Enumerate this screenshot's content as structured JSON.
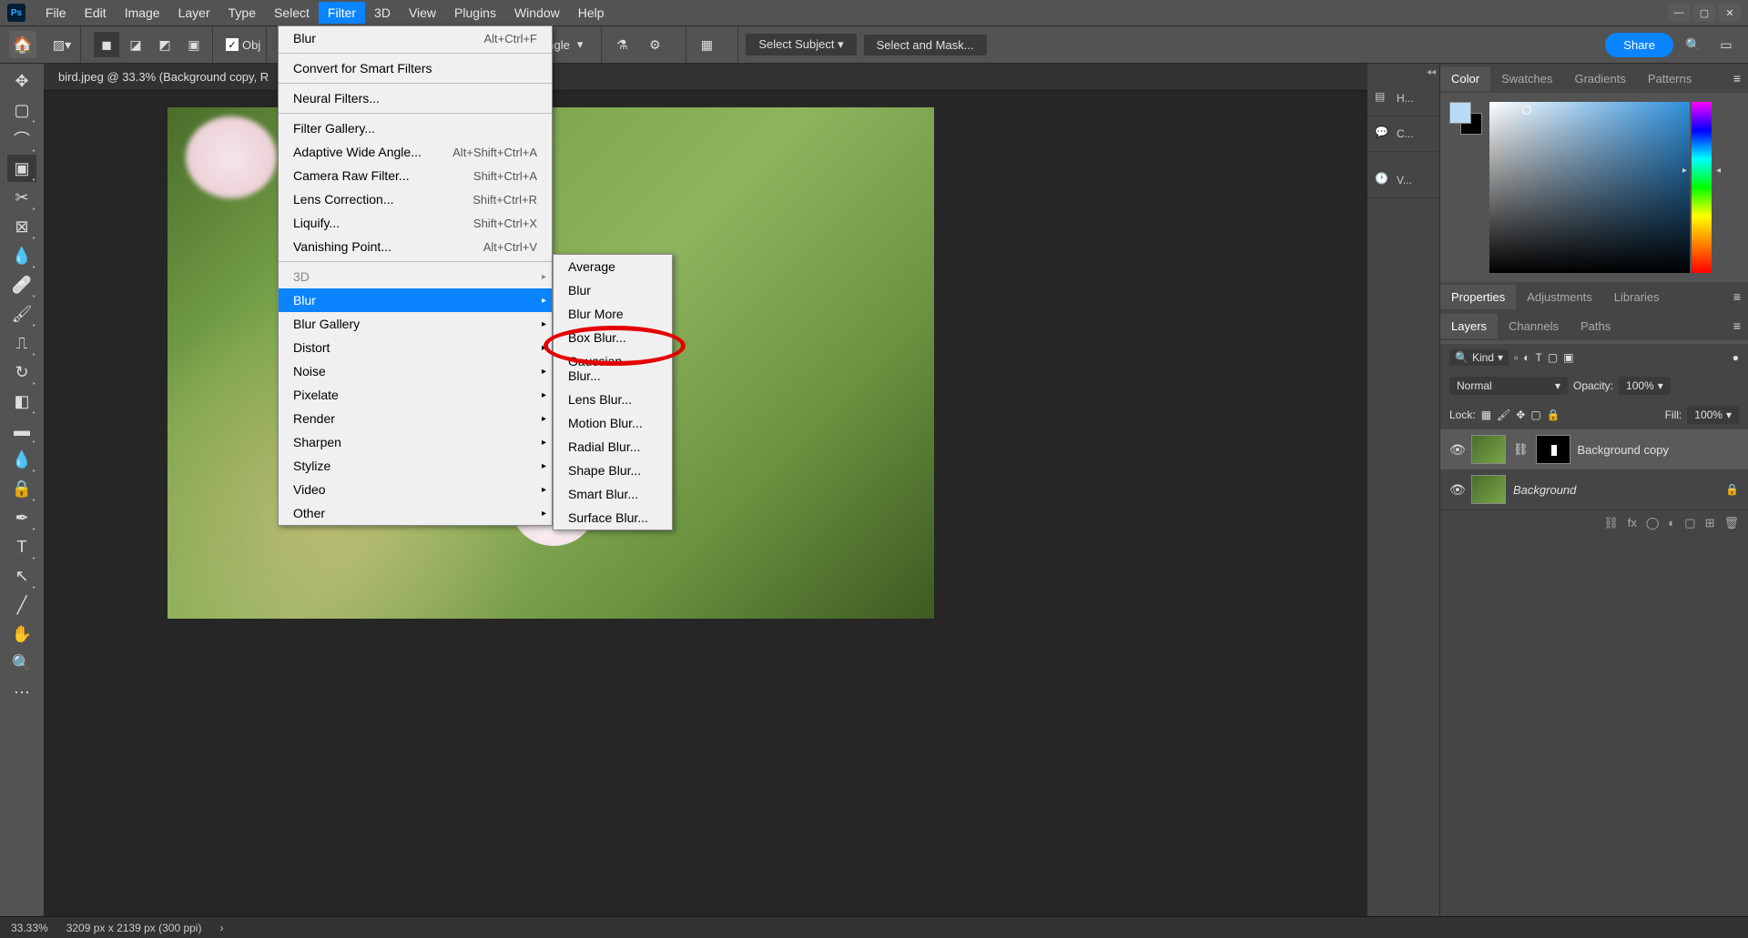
{
  "menubar": {
    "items": [
      "File",
      "Edit",
      "Image",
      "Layer",
      "Type",
      "Select",
      "Filter",
      "3D",
      "View",
      "Plugins",
      "Window",
      "Help"
    ],
    "active": "Filter"
  },
  "optionsbar": {
    "obj_label": "Obj",
    "style_label": "ngle",
    "select_subject": "Select Subject",
    "select_mask": "Select and Mask...",
    "share": "Share"
  },
  "doc_tab": "bird.jpeg @ 33.3% (Background copy, R",
  "filter_menu": {
    "last": {
      "label": "Blur",
      "shortcut": "Alt+Ctrl+F"
    },
    "convert": "Convert for Smart Filters",
    "neural": "Neural Filters...",
    "gallery": "Filter Gallery...",
    "adaptive": {
      "label": "Adaptive Wide Angle...",
      "shortcut": "Alt+Shift+Ctrl+A"
    },
    "camera": {
      "label": "Camera Raw Filter...",
      "shortcut": "Shift+Ctrl+A"
    },
    "lens": {
      "label": "Lens Correction...",
      "shortcut": "Shift+Ctrl+R"
    },
    "liquify": {
      "label": "Liquify...",
      "shortcut": "Shift+Ctrl+X"
    },
    "vanishing": {
      "label": "Vanishing Point...",
      "shortcut": "Alt+Ctrl+V"
    },
    "subs": [
      "3D",
      "Blur",
      "Blur Gallery",
      "Distort",
      "Noise",
      "Pixelate",
      "Render",
      "Sharpen",
      "Stylize",
      "Video",
      "Other"
    ]
  },
  "blur_submenu": [
    "Average",
    "Blur",
    "Blur More",
    "Box Blur...",
    "Gaussian Blur...",
    "Lens Blur...",
    "Motion Blur...",
    "Radial Blur...",
    "Shape Blur...",
    "Smart Blur...",
    "Surface Blur..."
  ],
  "right": {
    "mini": [
      "H...",
      "C...",
      "V..."
    ],
    "color_tabs": [
      "Color",
      "Swatches",
      "Gradients",
      "Patterns"
    ],
    "props_tabs": [
      "Properties",
      "Adjustments",
      "Libraries"
    ],
    "layers_tabs": [
      "Layers",
      "Channels",
      "Paths"
    ],
    "kind": "Kind",
    "blend_mode": "Normal",
    "opacity_label": "Opacity:",
    "opacity_val": "100%",
    "lock_label": "Lock:",
    "fill_label": "Fill:",
    "fill_val": "100%",
    "layers": [
      {
        "name": "Background copy",
        "locked": false
      },
      {
        "name": "Background",
        "locked": true
      }
    ]
  },
  "statusbar": {
    "zoom": "33.33%",
    "dims": "3209 px x 2139 px (300 ppi)"
  }
}
